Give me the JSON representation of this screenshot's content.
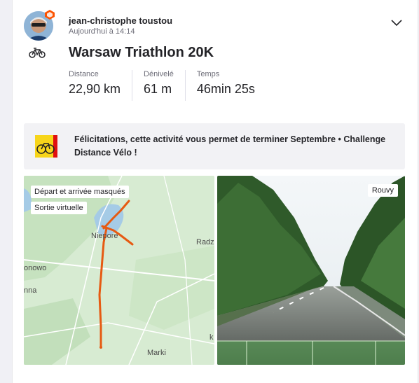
{
  "athlete": {
    "name": "jean-christophe toustou",
    "timestamp": "Aujourd'hui à 14:14"
  },
  "activity": {
    "title": "Warsaw Triathlon 20K",
    "sport_icon": "bike-icon",
    "stats": [
      {
        "label": "Distance",
        "value": "22,90 km"
      },
      {
        "label": "Dénivelé",
        "value": "61 m"
      },
      {
        "label": "Temps",
        "value": "46min 25s"
      }
    ]
  },
  "banner": {
    "text": "Félicitations, cette activité vous permet de terminer Septembre • Challenge Distance Vélo !",
    "icon": "challenge-badge-icon"
  },
  "map": {
    "labels": [
      "Départ et arrivée masqués",
      "Sortie virtuelle"
    ],
    "places": [
      "Niepore",
      "Radz",
      "onowo",
      "nna",
      "Marki",
      "k"
    ]
  },
  "media": {
    "label": "Rouvy"
  },
  "colors": {
    "route": "#e65a12",
    "accent": "#fc5200",
    "card_bg": "#ffffff",
    "banner_bg": "#f2f2f5",
    "map_bg": "#d7ebd2",
    "water": "#a5cbe6"
  }
}
